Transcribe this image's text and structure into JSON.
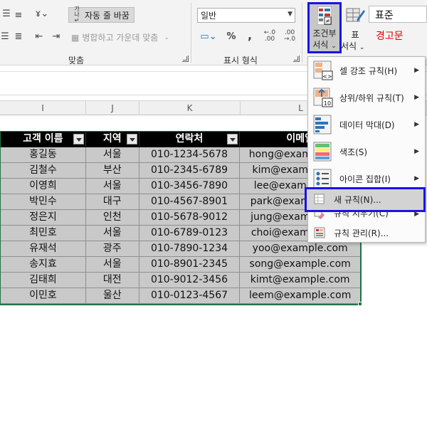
{
  "ribbon": {
    "wrap_text": "자동 줄 바꿈",
    "merge_center": "병합하고 가운데 맞춤",
    "alignment_label": "맞춤",
    "number_format_value": "일반",
    "number_group_label": "표시 형식",
    "percent": "%",
    "comma": ",",
    "cond_format_line1": "조건부",
    "cond_format_line2": "서식",
    "format_table_line1": "표",
    "format_table_line2": "서식",
    "style_normal": "표준",
    "style_bad": "경고문"
  },
  "columns": [
    "I",
    "J",
    "K",
    "L"
  ],
  "table": {
    "headers": [
      "고객 이름",
      "지역",
      "연락처",
      "이메일"
    ],
    "rows": [
      [
        "홍길동",
        "서울",
        "010-1234-5678",
        "hong@example.com"
      ],
      [
        "김철수",
        "부산",
        "010-2345-6789",
        "kim@example.com"
      ],
      [
        "이영희",
        "서울",
        "010-3456-7890",
        "lee@example.com"
      ],
      [
        "박민수",
        "대구",
        "010-4567-8901",
        "park@example.com"
      ],
      [
        "정은지",
        "인천",
        "010-5678-9012",
        "jung@example.com"
      ],
      [
        "최민호",
        "서울",
        "010-6789-0123",
        "choi@example.com"
      ],
      [
        "유재석",
        "광주",
        "010-7890-1234",
        "yoo@example.com"
      ],
      [
        "송지효",
        "서울",
        "010-8901-2345",
        "song@example.com"
      ],
      [
        "김태희",
        "대전",
        "010-9012-3456",
        "kimt@example.com"
      ],
      [
        "이민호",
        "울산",
        "010-0123-4567",
        "leem@example.com"
      ]
    ]
  },
  "menu": {
    "items": [
      {
        "label": "셀 강조 규칙(H)",
        "icon": "highlight-cells-icon"
      },
      {
        "label": "상위/하위 규칙(T)",
        "icon": "top-bottom-icon"
      },
      {
        "label": "데이터 막대(D)",
        "icon": "data-bars-icon"
      },
      {
        "label": "색조(S)",
        "icon": "color-scales-icon"
      },
      {
        "label": "아이콘 집합(I)",
        "icon": "icon-sets-icon"
      }
    ],
    "new_rule": "새 규칙(N)...",
    "clear_rules": "규칙 지우기(C)",
    "manage_rules": "규칙 관리(R)..."
  },
  "colors": {
    "highlight_border": "#1a12e8",
    "table_header_bg": "#000000",
    "table_row_bg": "#c9c9c9",
    "selection_border": "#217346",
    "bad_style_text": "#e00000"
  }
}
